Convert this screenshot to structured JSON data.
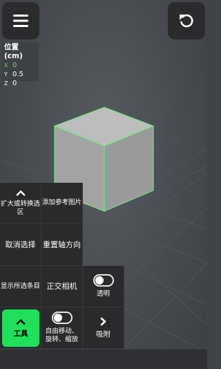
{
  "toolbar": {
    "menu_icon": "hamburger-menu-icon",
    "undo_icon": "undo-icon"
  },
  "position_panel": {
    "title": "位置 (cm)",
    "x_label": "X",
    "x_value": "0",
    "y_label": "Y",
    "y_value": "0.5",
    "z_label": "Z",
    "z_value": "0",
    "x_color": "#5ee65e"
  },
  "menu": {
    "expand_label": "扩大或转换选区",
    "add_reference_label": "添加参考图片",
    "deselect_label": "取消选择",
    "reset_axis_label": "重置轴方向",
    "show_all_label": "显示所选条目",
    "ortho_camera_label": "正交相机",
    "transparent_label": "透明",
    "transparent_on": false,
    "tools_label": "工具",
    "free_move_label": "自由移动、旋转、缩放",
    "free_move_on": false,
    "snap_label": "吸附"
  },
  "colors": {
    "accent": "#1ee05a",
    "selection_outline": "#6fe87a",
    "panel": "#2a2a2c"
  }
}
